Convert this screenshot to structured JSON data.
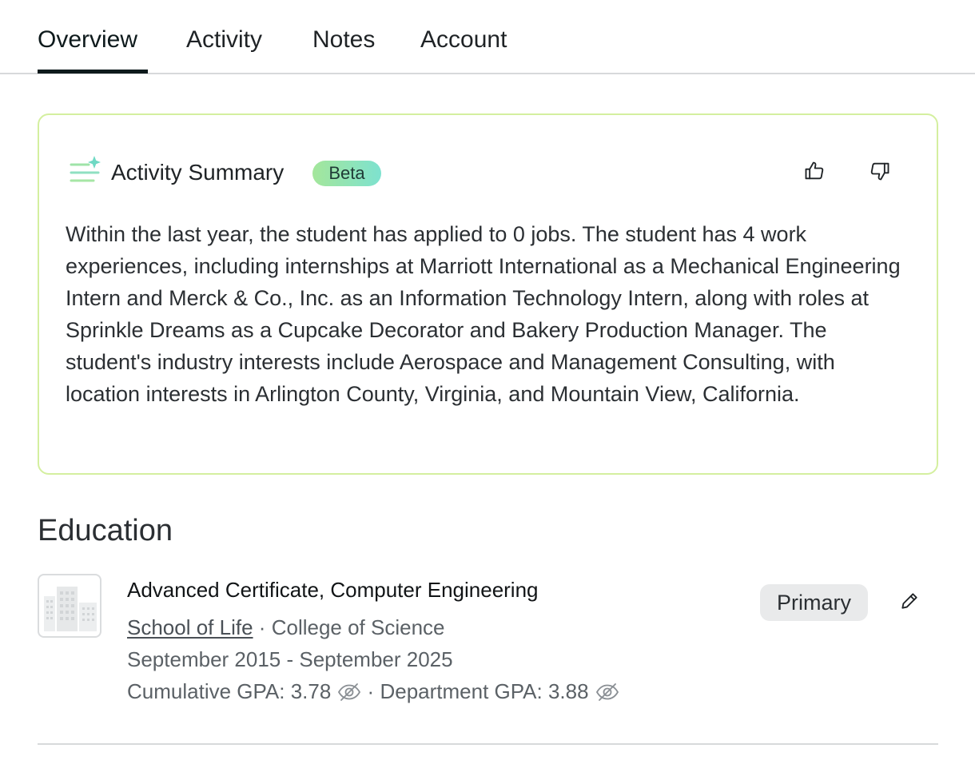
{
  "tabs": [
    {
      "label": "Overview",
      "active": true
    },
    {
      "label": "Activity",
      "active": false
    },
    {
      "label": "Notes",
      "active": false
    },
    {
      "label": "Account",
      "active": false
    }
  ],
  "summary": {
    "title": "Activity Summary",
    "badge": "Beta",
    "icon": "sparkle-lines-icon",
    "text": "Within the last year, the student has applied to 0 jobs. The student has 4 work experiences, including internships at Marriott International as a Mechanical Engineering Intern and Merck & Co., Inc. as an Information Technology Intern, along with roles at Sprinkle Dreams as a Cupcake Decorator and Bakery Production Manager. The student's industry interests include Aerospace and Management Consulting, with location interests in Arlington County, Virginia, and Mountain View, California.",
    "border_color": "#d4ef9f"
  },
  "education": {
    "heading": "Education",
    "entries": [
      {
        "degree": "Advanced Certificate, Computer Engineering",
        "school": "School of Life",
        "separator": "·",
        "college": "College of Science",
        "dates": "September 2015 - September 2025",
        "cumulative_gpa": "Cumulative GPA: 3.78",
        "department_gpa": "Department GPA: 3.88",
        "badge": "Primary"
      }
    ]
  },
  "colors": {
    "active_tab": "#0e1a1c",
    "badge_gradient_start": "#a4e69b",
    "badge_gradient_end": "#7ee2cf"
  }
}
